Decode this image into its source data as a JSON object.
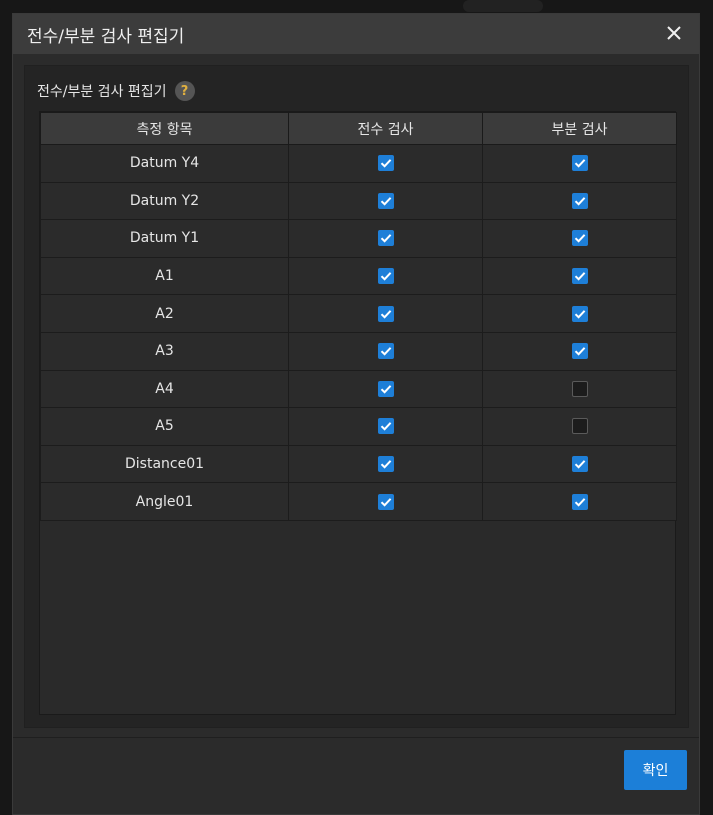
{
  "dialog": {
    "title": "전수/부분 검사 편집기",
    "close_icon": "close-icon"
  },
  "panel": {
    "header": "전수/부분 검사 편집기",
    "help_icon": "?"
  },
  "table": {
    "columns": [
      "측정 항목",
      "전수 검사",
      "부분 검사"
    ],
    "rows": [
      {
        "name": "Datum Y4",
        "full": true,
        "partial": true
      },
      {
        "name": "Datum Y2",
        "full": true,
        "partial": true
      },
      {
        "name": "Datum Y1",
        "full": true,
        "partial": true
      },
      {
        "name": "A1",
        "full": true,
        "partial": true
      },
      {
        "name": "A2",
        "full": true,
        "partial": true
      },
      {
        "name": "A3",
        "full": true,
        "partial": true
      },
      {
        "name": "A4",
        "full": true,
        "partial": false
      },
      {
        "name": "A5",
        "full": true,
        "partial": false
      },
      {
        "name": "Distance01",
        "full": true,
        "partial": true
      },
      {
        "name": "Angle01",
        "full": true,
        "partial": true
      }
    ]
  },
  "footer": {
    "confirm_label": "확인"
  },
  "colors": {
    "accent": "#1c7fd8",
    "dialog_bg": "#2b2b2b",
    "title_bar": "#3c3c3c"
  }
}
